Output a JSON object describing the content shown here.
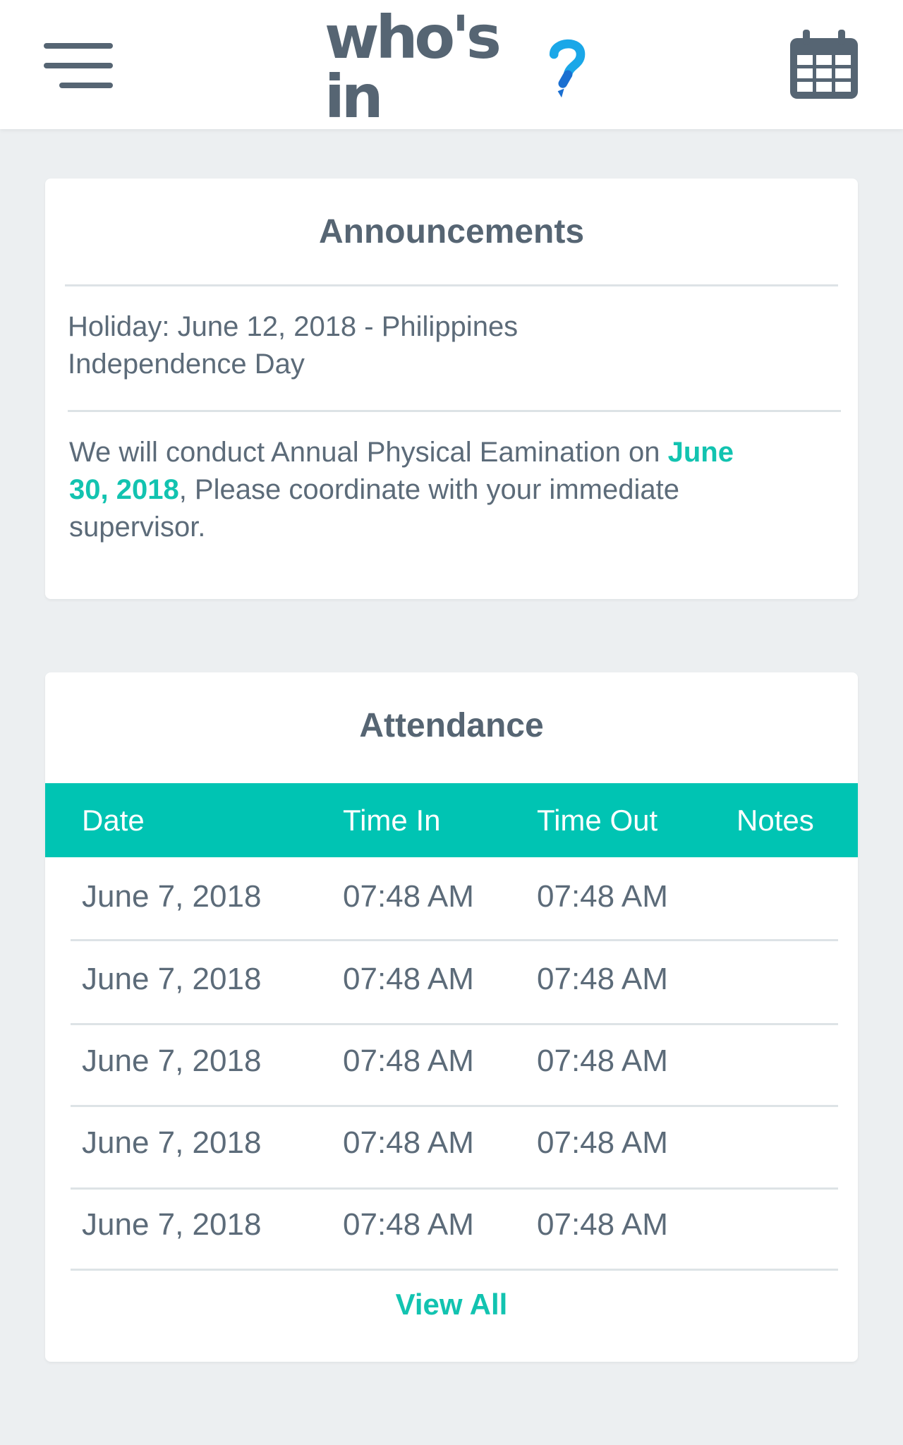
{
  "header": {
    "logo_text": "who's in",
    "logo_mark": "?",
    "menu_icon": "hamburger-menu-icon",
    "calendar_icon": "calendar-icon"
  },
  "announcements": {
    "title": "Announcements",
    "items": [
      {
        "line1": "Holiday: June 12, 2018 - Philippines",
        "line2": "Independence Day"
      },
      {
        "pre": "We will conduct Annual Physical Eamination on ",
        "highlight_a": "June",
        "highlight_b": "30, 2018",
        "post_a": ", Please coordinate with your immediate",
        "post_b": "supervisor."
      }
    ]
  },
  "attendance": {
    "title": "Attendance",
    "columns": [
      "Date",
      "Time In",
      "Time Out",
      "Notes"
    ],
    "rows": [
      [
        "June 7, 2018",
        "07:48 AM",
        "07:48 AM",
        ""
      ],
      [
        "June 7, 2018",
        "07:48 AM",
        "07:48 AM",
        ""
      ],
      [
        "June 7, 2018",
        "07:48 AM",
        "07:48 AM",
        ""
      ],
      [
        "June 7, 2018",
        "07:48 AM",
        "07:48 AM",
        ""
      ],
      [
        "June 7, 2018",
        "07:48 AM",
        "07:48 AM",
        ""
      ]
    ],
    "view_all_label": "View All"
  },
  "colors": {
    "accent": "#00c4b3",
    "text": "#566573",
    "background": "#eceff1"
  }
}
